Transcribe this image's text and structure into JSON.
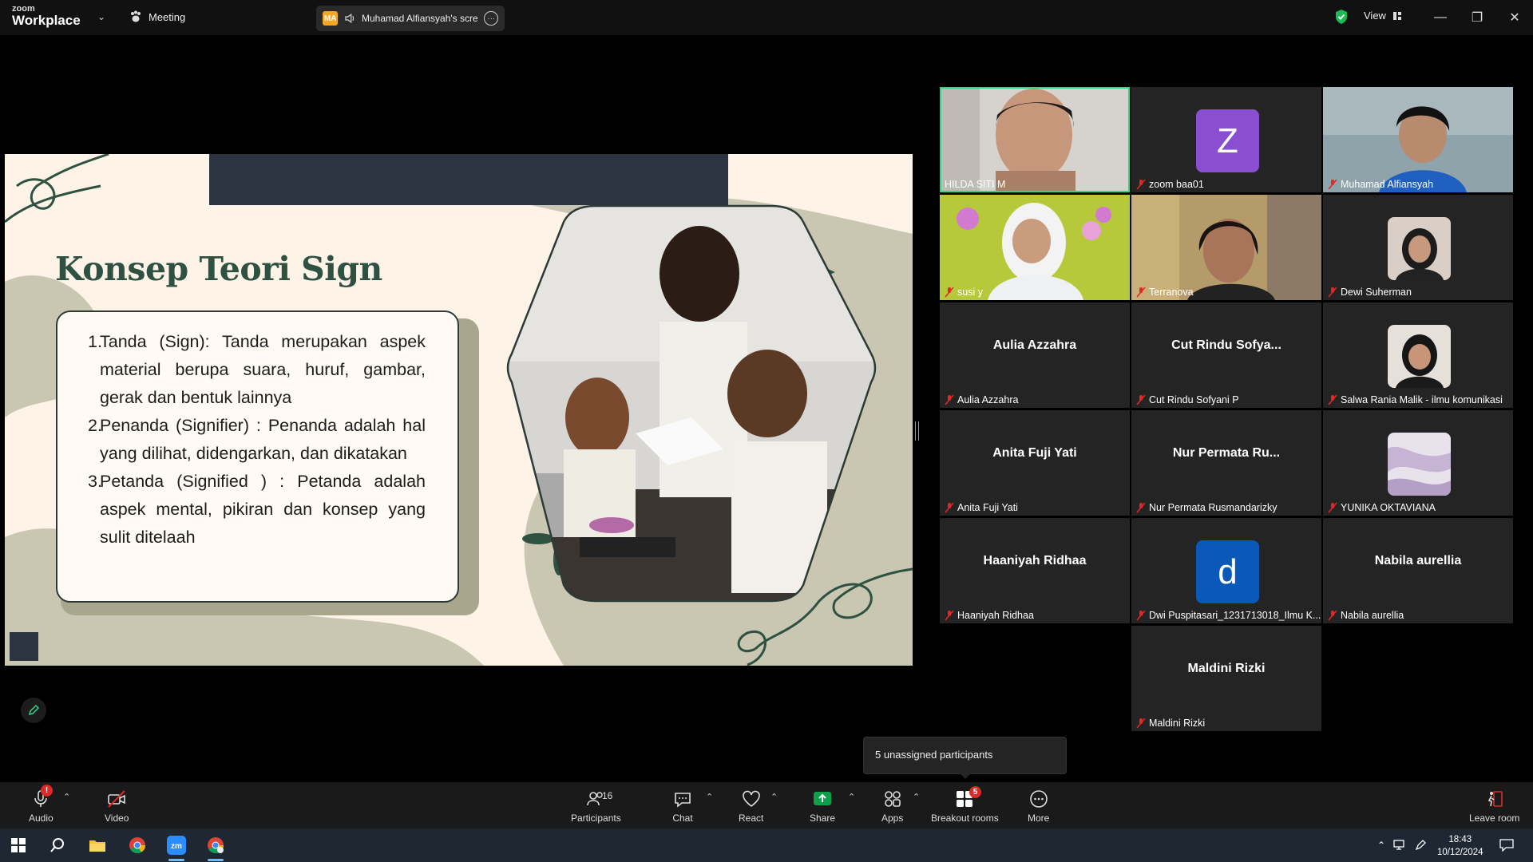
{
  "app": {
    "logo_small": "zoom",
    "logo_big": "Workplace",
    "meeting_label": "Meeting",
    "share_initials": "MA",
    "share_label": "Muhamad Alfiansyah's screen",
    "view_label": "View"
  },
  "slide": {
    "title": "Konsep Teori Sign",
    "items": [
      {
        "num": "1.",
        "text": "Tanda (Sign): Tanda merupakan aspek material berupa suara, huruf, gambar, gerak dan bentuk lainnya"
      },
      {
        "num": "2.",
        "text": "Penanda (Signifier) : Penanda adalah hal yang dilihat, didengarkan, dan dikatakan"
      },
      {
        "num": "3.",
        "text": "Petanda (Signified ) : Petanda adalah aspek mental, pikiran dan konsep yang sulit ditelaah"
      }
    ]
  },
  "participants": [
    {
      "label": "HILDA SITI M",
      "center": "",
      "muted": false
    },
    {
      "label": "zoom baa01",
      "center": "",
      "avatar_letter": "Z",
      "muted": true
    },
    {
      "label": "Muhamad Alfiansyah",
      "center": "",
      "muted": true
    },
    {
      "label": "susi y",
      "center": "",
      "muted": true
    },
    {
      "label": "Terranova",
      "center": "",
      "muted": true
    },
    {
      "label": "Dewi Suherman",
      "center": "",
      "muted": true
    },
    {
      "label": "Aulia Azzahra",
      "center": "Aulia Azzahra",
      "muted": true
    },
    {
      "label": "Cut Rindu Sofyani P",
      "center": "Cut Rindu Sofya...",
      "muted": true
    },
    {
      "label": "Salwa Rania Malik - ilmu komunikasi",
      "center": "",
      "muted": true
    },
    {
      "label": "Anita Fuji Yati",
      "center": "Anita Fuji Yati",
      "muted": true
    },
    {
      "label": "Nur Permata Rusmandarizky",
      "center": "Nur Permata Ru...",
      "muted": true
    },
    {
      "label": "YUNIKA OKTAVIANA",
      "center": "",
      "muted": true
    },
    {
      "label": "Haaniyah Ridhaa",
      "center": "Haaniyah Ridhaa",
      "muted": true
    },
    {
      "label": "Dwi Puspitasari_1231713018_Ilmu K...",
      "center": "",
      "avatar_letter": "d",
      "muted": true
    },
    {
      "label": "Nabila aurellia",
      "center": "Nabila aurellia",
      "muted": true
    },
    {
      "label": "Maldini Rizki",
      "center": "Maldini Rizki",
      "muted": true
    }
  ],
  "tooltip": "5 unassigned participants",
  "toolbar": {
    "audio": "Audio",
    "video": "Video",
    "participants": "Participants",
    "participants_count": "16",
    "chat": "Chat",
    "react": "React",
    "share": "Share",
    "apps": "Apps",
    "breakout": "Breakout rooms",
    "breakout_badge": "5",
    "more": "More",
    "leave": "Leave room"
  },
  "taskbar": {
    "time": "18:43",
    "date": "10/12/2024"
  },
  "colors": {
    "slide_title": "#2e5142",
    "active_speaker": "#31d68a",
    "share_green": "#0e9f4a"
  }
}
